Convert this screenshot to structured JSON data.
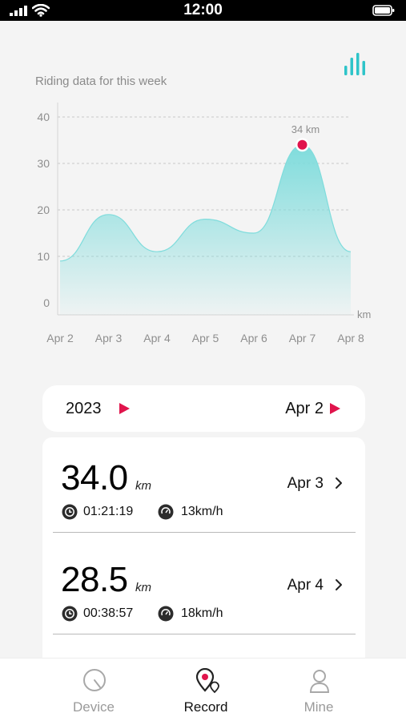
{
  "status_bar": {
    "time": "12:00"
  },
  "header": {
    "stats_icon": "bar-chart-icon",
    "accent_color": "#2ec4c9"
  },
  "chart": {
    "title": "Riding data for this week"
  },
  "chart_data": {
    "type": "area",
    "title": "Riding data for this week",
    "ylabel": "",
    "y_unit": "km",
    "categories": [
      "Apr 2",
      "Apr 3",
      "Apr 4",
      "Apr 5",
      "Apr 6",
      "Apr 7",
      "Apr 8"
    ],
    "values": [
      9,
      19,
      11,
      18,
      15,
      34,
      11
    ],
    "y_ticks": [
      "0",
      "10",
      "20",
      "30",
      "40"
    ],
    "ylim": [
      0,
      40
    ],
    "grid": true,
    "highlight": {
      "category": "Apr 7",
      "value": 34,
      "label": "34 km",
      "color": "#e0144c"
    },
    "fill_color": "#7fdcdc"
  },
  "selector": {
    "year": "2023",
    "date": "Apr 2",
    "arrow_color": "#e0144c"
  },
  "records": [
    {
      "distance": "34.0",
      "unit": "km",
      "date": "Apr 3",
      "duration": "01:21:19",
      "speed": "13km/h"
    },
    {
      "distance": "28.5",
      "unit": "km",
      "date": "Apr 4",
      "duration": "00:38:57",
      "speed": "18km/h"
    }
  ],
  "tabs": [
    {
      "label": "Device",
      "icon": "speedometer-icon",
      "active": false
    },
    {
      "label": "Record",
      "icon": "map-pin-icon",
      "active": true
    },
    {
      "label": "Mine",
      "icon": "user-icon",
      "active": false
    }
  ]
}
